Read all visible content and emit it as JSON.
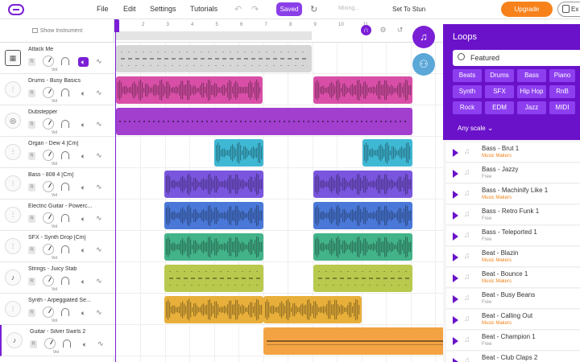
{
  "topbar": {
    "menu": [
      "File",
      "Edit",
      "Settings",
      "Tutorials"
    ],
    "saved_label": "Saved",
    "status_text": "Mixing...",
    "song_title": "Set To Stun",
    "upgrade_label": "Upgrade",
    "export_label": "Ex"
  },
  "track_panel": {
    "show_instrument_label": "Show Instrument",
    "r_label": "R",
    "vol_label": "Vol"
  },
  "tracks": [
    {
      "name": "Attack Me",
      "icon": "keyboard-icon",
      "muted": true
    },
    {
      "name": "Drums - Busy Basics",
      "icon": "waveform-icon",
      "muted": false
    },
    {
      "name": "Dubstepper",
      "icon": "drum-icon",
      "muted": false
    },
    {
      "name": "Organ - Dew 4 [Cm]",
      "icon": "waveform-icon",
      "muted": false
    },
    {
      "name": "Bass - 808 4 [Cm]",
      "icon": "waveform-icon",
      "muted": false
    },
    {
      "name": "Electric Guitar - Powerc...",
      "icon": "waveform-icon",
      "muted": false
    },
    {
      "name": "SFX - Synth Drop [Cm]",
      "icon": "waveform-icon",
      "muted": false
    },
    {
      "name": "Strings - Juicy Stab",
      "icon": "violin-icon",
      "muted": false
    },
    {
      "name": "Synth - Arpeggiated Se...",
      "icon": "waveform-icon",
      "muted": false
    },
    {
      "name": "Guitar - Silver Swirls 2",
      "icon": "guitar-icon",
      "muted": false,
      "selected": true
    }
  ],
  "ruler": {
    "numbers": [
      "2",
      "3",
      "4",
      "5",
      "6",
      "7",
      "8",
      "9",
      "10",
      "11"
    ]
  },
  "loops": {
    "title": "Loops",
    "search_value": "Featured",
    "genres": [
      "Beats",
      "Drums",
      "Bass",
      "Piano",
      "Synth",
      "SFX",
      "Hip Hop",
      "RnB",
      "Rock",
      "EDM",
      "Jazz",
      "MIDI"
    ],
    "scale_label": "Any scale",
    "items": [
      {
        "name": "Bass - Brut 1",
        "sub": "Music Makers",
        "maker": true
      },
      {
        "name": "Bass - Jazzy",
        "sub": "Free",
        "maker": false
      },
      {
        "name": "Bass - Machinify Like 1",
        "sub": "Music Makers",
        "maker": true
      },
      {
        "name": "Bass - Retro Funk 1",
        "sub": "Free",
        "maker": false
      },
      {
        "name": "Bass - Teleported 1",
        "sub": "Free",
        "maker": false
      },
      {
        "name": "Beat - Blazin",
        "sub": "Music Makers",
        "maker": true
      },
      {
        "name": "Beat - Bounce 1",
        "sub": "Music Makers",
        "maker": true
      },
      {
        "name": "Beat - Busy Beans",
        "sub": "Free",
        "maker": false
      },
      {
        "name": "Beat - Calling Out",
        "sub": "Music Makers",
        "maker": true
      },
      {
        "name": "Beat - Champion 1",
        "sub": "Free",
        "maker": false
      },
      {
        "name": "Beat - Club Claps 2",
        "sub": "",
        "maker": false
      }
    ]
  },
  "colors": {
    "accent": "#7a1fd6",
    "loops_header": "#6a12c9",
    "genre_button": "#8d3ff0",
    "upgrade": "#f7821b",
    "clip_grey": "#d6d6d6",
    "clip_pink": "#d94fa8",
    "clip_purple": "#a23fcf",
    "clip_cyan": "#3fb8d4",
    "clip_indigo": "#7a55de",
    "clip_blue": "#4a78d8",
    "clip_green": "#43b389",
    "clip_lime": "#b8c94e",
    "clip_yellow": "#e8b03a",
    "clip_orange": "#f3a343"
  }
}
